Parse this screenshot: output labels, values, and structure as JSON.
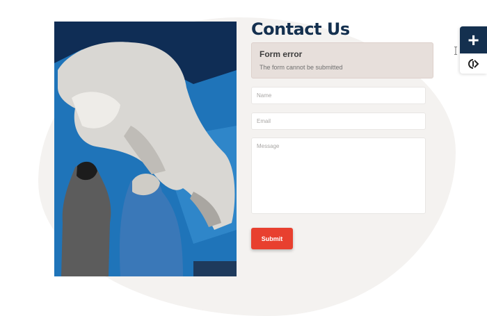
{
  "page": {
    "title": "Contact Us"
  },
  "photo": {
    "alt": "polar bear",
    "icon": "photo-image"
  },
  "alert": {
    "title": "Form error",
    "message": "The form cannot be submitted"
  },
  "form": {
    "name_placeholder": "Name",
    "email_placeholder": "Email",
    "message_placeholder": "Message",
    "name_value": "",
    "email_value": "",
    "message_value": "",
    "submit_label": "Submit"
  },
  "side_panel": {
    "top_icon": "plus-icon",
    "bottom_icon": "accessibility-icon"
  },
  "colors": {
    "accent": "#e8402f",
    "title": "#14304f",
    "alert_bg": "#e7dfdb"
  }
}
